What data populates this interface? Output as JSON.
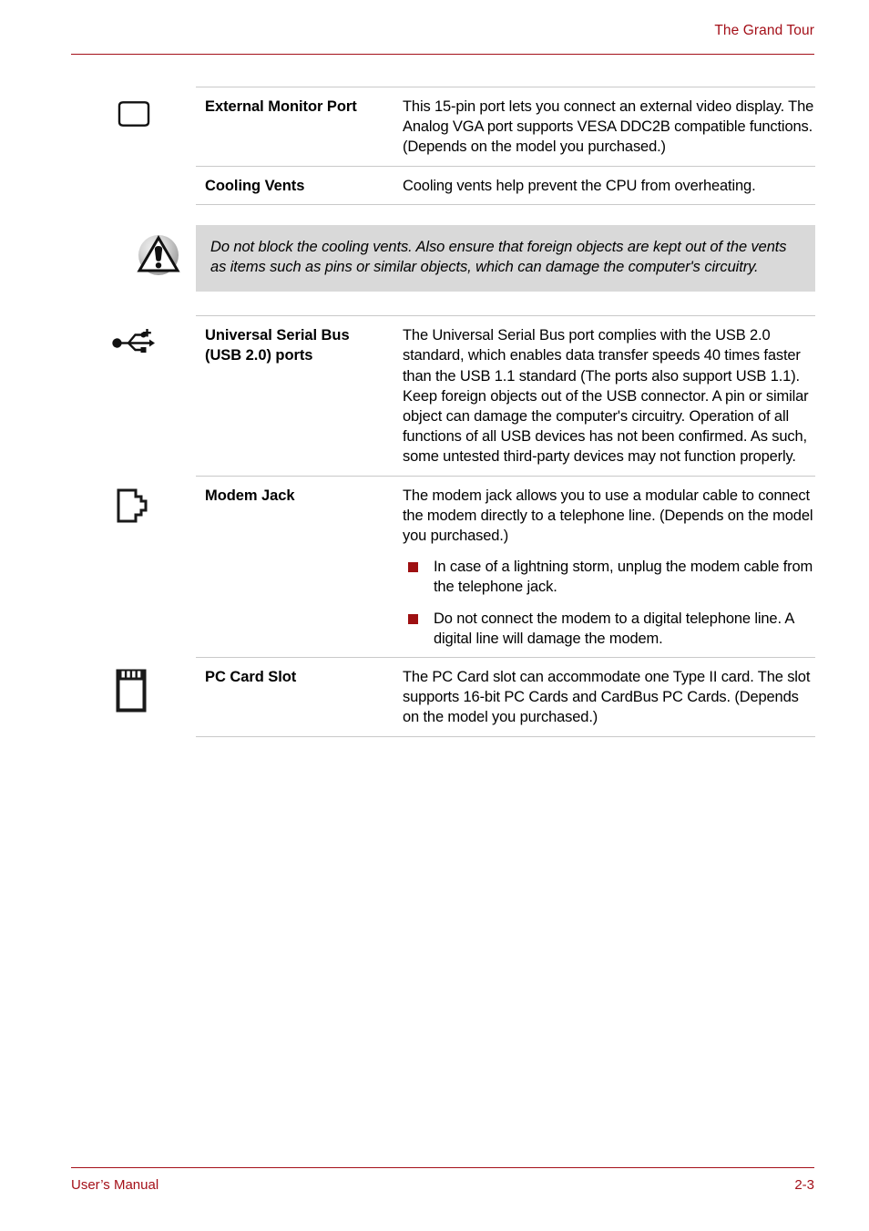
{
  "header": {
    "title": "The Grand Tour"
  },
  "footer": {
    "manual_label": "User’s Manual",
    "page_number": "2-3"
  },
  "colors": {
    "accent_red": "#A41019",
    "bullet_red": "#9E1012",
    "caution_background": "#D9D9D9",
    "rule_gray": "#C9C9C9",
    "text_black": "#000000"
  },
  "spec_table": {
    "rows": [
      {
        "icon": "external-monitor-port-icon",
        "term": "External Monitor Port",
        "description": "This 15-pin port lets you connect an external video display. The Analog VGA port supports VESA DDC2B compatible functions. (Depends on the model you purchased.)",
        "bullets": []
      },
      {
        "icon": null,
        "term": "Cooling Vents",
        "description": "Cooling vents help prevent the CPU from overheating.",
        "bullets": []
      }
    ]
  },
  "caution": {
    "icon": "warning-triangle-icon",
    "text": "Do not block the cooling vents. Also ensure that foreign objects are kept out of the vents as items such as pins or similar objects, which can damage the computer's circuitry."
  },
  "spec_table_2": {
    "rows": [
      {
        "icon": "usb-icon",
        "term": "Universal Serial Bus (USB 2.0) ports",
        "term_line1": "Universal Serial Bus",
        "term_line2": "(USB 2.0) ports",
        "description": "The Universal Serial Bus port complies with the USB 2.0 standard, which enables data transfer speeds 40 times faster than the USB 1.1 standard (The ports also support USB 1.1). Keep foreign objects out of the USB connector. A pin or similar object can damage the computer's circuitry. Operation of all functions of all USB devices has not been confirmed. As such, some untested third-party devices may not function properly.",
        "bullets": []
      },
      {
        "icon": "modem-jack-icon",
        "term": "Modem Jack",
        "description": "The modem jack allows you to use a modular cable to connect the modem directly to a telephone line. (Depends on the model you purchased.)",
        "bullets": [
          "In case of a lightning storm, unplug the modem cable from the telephone jack.",
          "Do not connect the modem to a digital telephone line. A digital line will damage the modem."
        ]
      },
      {
        "icon": "pc-card-slot-icon",
        "term": "PC Card Slot",
        "description": "The PC Card slot can accommodate one Type II card. The slot supports 16-bit PC Cards and CardBus PC Cards. (Depends on the model you purchased.)",
        "bullets": []
      }
    ]
  }
}
